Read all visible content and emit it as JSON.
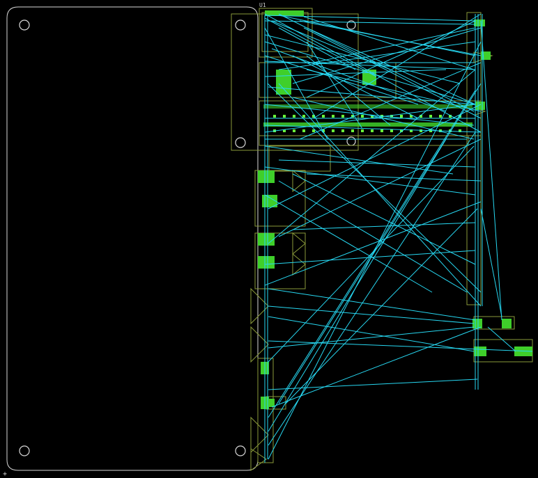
{
  "app": {
    "view": "pcb-layout-ratsnest"
  },
  "colors": {
    "background": "#000000",
    "board_outline": "#d8d8d8",
    "ratsnest": "#27d8f2",
    "silkscreen": "#8a9a3a",
    "pads": "#3fcf2a",
    "component_outline": "#b8c45a"
  },
  "labels": {
    "top_ref": "U1",
    "origin_marker": "+"
  }
}
